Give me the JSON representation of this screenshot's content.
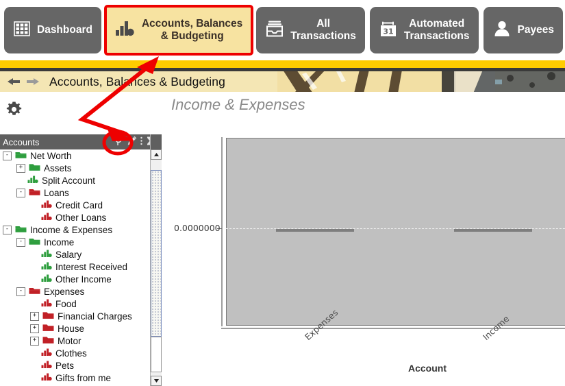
{
  "tabs": [
    {
      "label": "Dashboard",
      "icon": "grid-icon",
      "selected": false
    },
    {
      "label": "Accounts, Balances\n& Budgeting",
      "icon": "bar-chart-icon",
      "selected": true
    },
    {
      "label": "All\nTransactions",
      "icon": "inbox-tray-icon",
      "selected": false
    },
    {
      "label": "Automated\nTransactions",
      "icon": "calendar-31-icon",
      "selected": false
    },
    {
      "label": "Payees",
      "icon": "person-icon",
      "selected": false
    },
    {
      "label": "",
      "icon": "double-chevron-right-icon",
      "selected": false
    }
  ],
  "breadcrumb": {
    "back_icon": "arrow-left-icon",
    "forward_icon": "arrow-right-icon",
    "title": "Accounts, Balances & Budgeting"
  },
  "toolbar": {
    "settings_icon": "gear-icon"
  },
  "panel": {
    "title": "Income & Expenses"
  },
  "sidebar": {
    "header": "Accounts",
    "header_icons": [
      "search-icon",
      "pencil-edit-icon",
      "more-options-icon",
      "collapse-all-icon"
    ],
    "tree": [
      {
        "label": "Net Worth",
        "depth": 0,
        "expander": "-",
        "icon": "folder-open-green",
        "color": "#2e9e3e"
      },
      {
        "label": "Assets",
        "depth": 1,
        "expander": "+",
        "icon": "folder-green",
        "color": "#2e9e3e"
      },
      {
        "label": "Split Account",
        "depth": 1,
        "expander": "",
        "icon": "account-green",
        "color": "#2e9e3e"
      },
      {
        "label": "Loans",
        "depth": 1,
        "expander": "-",
        "icon": "folder-open-red",
        "color": "#c12026"
      },
      {
        "label": "Credit Card",
        "depth": 2,
        "expander": "",
        "icon": "account-red",
        "color": "#c12026"
      },
      {
        "label": "Other Loans",
        "depth": 2,
        "expander": "",
        "icon": "account-red",
        "color": "#c12026"
      },
      {
        "label": "Income & Expenses",
        "depth": 0,
        "expander": "-",
        "icon": "folder-open-green",
        "color": "#2e9e3e"
      },
      {
        "label": "Income",
        "depth": 1,
        "expander": "-",
        "icon": "folder-open-green",
        "color": "#2e9e3e"
      },
      {
        "label": "Salary",
        "depth": 2,
        "expander": "",
        "icon": "account-green",
        "color": "#2e9e3e"
      },
      {
        "label": "Interest Received",
        "depth": 2,
        "expander": "",
        "icon": "account-green",
        "color": "#2e9e3e"
      },
      {
        "label": "Other Income",
        "depth": 2,
        "expander": "",
        "icon": "account-green",
        "color": "#2e9e3e"
      },
      {
        "label": "Expenses",
        "depth": 1,
        "expander": "-",
        "icon": "folder-open-red",
        "color": "#c12026"
      },
      {
        "label": "Food",
        "depth": 2,
        "expander": "",
        "icon": "account-red",
        "color": "#c12026"
      },
      {
        "label": "Financial Charges",
        "depth": 2,
        "expander": "+",
        "icon": "folder-red",
        "color": "#c12026"
      },
      {
        "label": "House",
        "depth": 2,
        "expander": "+",
        "icon": "folder-red",
        "color": "#c12026"
      },
      {
        "label": "Motor",
        "depth": 2,
        "expander": "+",
        "icon": "folder-red",
        "color": "#c12026"
      },
      {
        "label": "Clothes",
        "depth": 2,
        "expander": "",
        "icon": "account-red",
        "color": "#c12026"
      },
      {
        "label": "Pets",
        "depth": 2,
        "expander": "",
        "icon": "account-red",
        "color": "#c12026"
      },
      {
        "label": "Gifts from me",
        "depth": 2,
        "expander": "",
        "icon": "account-red",
        "color": "#c12026"
      }
    ]
  },
  "chart_data": {
    "type": "bar",
    "title": "Income & Expenses",
    "categories": [
      "Expenses",
      "Income"
    ],
    "values": [
      0.0,
      0.0
    ],
    "xlabel": "Account",
    "ylabel": "",
    "ytick_labels": [
      "0.0000000"
    ],
    "ytick_values": [
      0.0
    ],
    "grid": true,
    "legend": "none",
    "plot_bgcolor": "#c0c0c0",
    "bar_color": "#7e7e7e",
    "xtick_rotation": -42,
    "note": "Both bars are zero-height, drawn flat on the 0.0000000 baseline; the 'Income' tick label is clipped by the right edge of the screenshot."
  },
  "annotation": {
    "arrow_color": "#ee0000",
    "circled_target": "pencil-edit-icon",
    "highlighted_tab": "Accounts, Balances & Budgeting"
  },
  "colors": {
    "tab_bg": "#666666",
    "tab_selected_bg": "#f7e3a1",
    "banner_yellow": "#ffcc00",
    "crumb_bg": "#f4e6b4",
    "annotation_red": "#ee0000",
    "green": "#2e9e3e",
    "red": "#c12026"
  }
}
